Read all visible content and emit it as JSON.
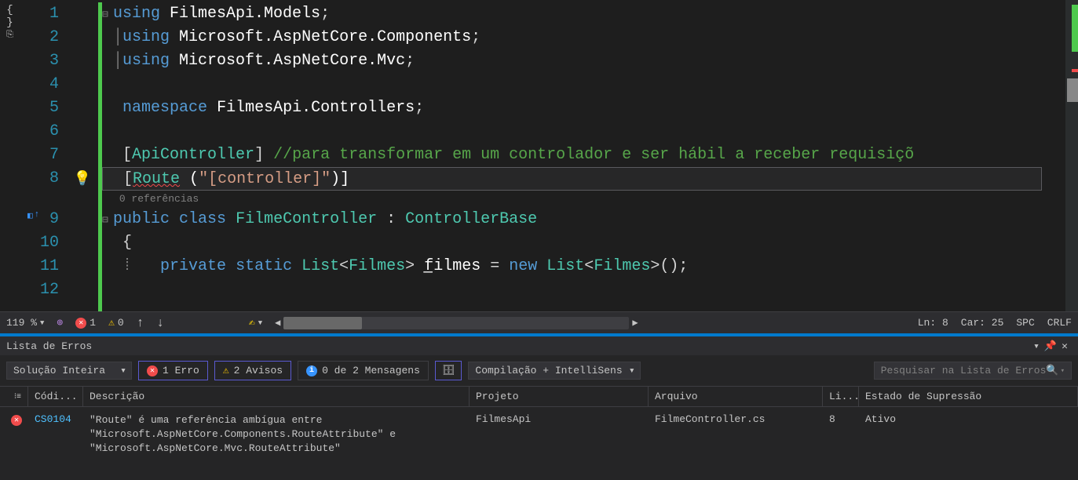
{
  "editor": {
    "lines": [
      {
        "num": 1
      },
      {
        "num": 2
      },
      {
        "num": 3
      },
      {
        "num": 4
      },
      {
        "num": 5
      },
      {
        "num": 6
      },
      {
        "num": 7
      },
      {
        "num": 8
      },
      {
        "num": 9
      },
      {
        "num": 10
      },
      {
        "num": 11
      },
      {
        "num": 12
      }
    ],
    "code": {
      "l1_using": "using",
      "l1_ns": "FilmesApi.Models",
      "l2_using": "using",
      "l2_ns": "Microsoft.AspNetCore.Components",
      "l3_using": "using",
      "l3_ns": "Microsoft.AspNetCore.Mvc",
      "l5_ns_kw": "namespace",
      "l5_ns": "FilmesApi.Controllers",
      "l7_attr": "ApiController",
      "l7_cmt": "//para transformar em um controlador e ser hábil a receber requisiçõ",
      "l8_route": "Route",
      "l8_args": " (",
      "l8_str": "\"[controller]\"",
      "l8_close": ")]",
      "l8_refs": "0 referências",
      "l9_public": "public",
      "l9_class": "class",
      "l9_name": "FilmeController",
      "l9_base": "ControllerBase",
      "l10_brace": "{",
      "l11_private": "private",
      "l11_static": "static",
      "l11_list": "List",
      "l11_t": "Filmes",
      "l11_field": "filmes",
      "l11_new": "new"
    }
  },
  "status": {
    "zoom": "119 %",
    "errors": "1",
    "warnings": "0",
    "ln": "Ln: 8",
    "car": "Car: 25",
    "spc": "SPC",
    "crlf": "CRLF"
  },
  "errorPanel": {
    "title": "Lista de Erros",
    "scope": "Solução Inteira",
    "filterErrors": "1 Erro",
    "filterWarnings": "2 Avisos",
    "filterMessages": "0 de 2 Mensagens",
    "buildSource": "Compilação + IntelliSens",
    "searchPlaceholder": "Pesquisar na Lista de Erros",
    "columns": {
      "code": "Códi...",
      "desc": "Descrição",
      "proj": "Projeto",
      "file": "Arquivo",
      "line": "Li...",
      "state": "Estado de Supressão"
    },
    "row": {
      "code": "CS0104",
      "desc": "\"Route\" é uma referência ambígua entre \"Microsoft.AspNetCore.Components.RouteAttribute\" e \"Microsoft.AspNetCore.Mvc.RouteAttribute\"",
      "proj": "FilmesApi",
      "file": "FilmeController.cs",
      "line": "8",
      "state": "Ativo"
    }
  }
}
